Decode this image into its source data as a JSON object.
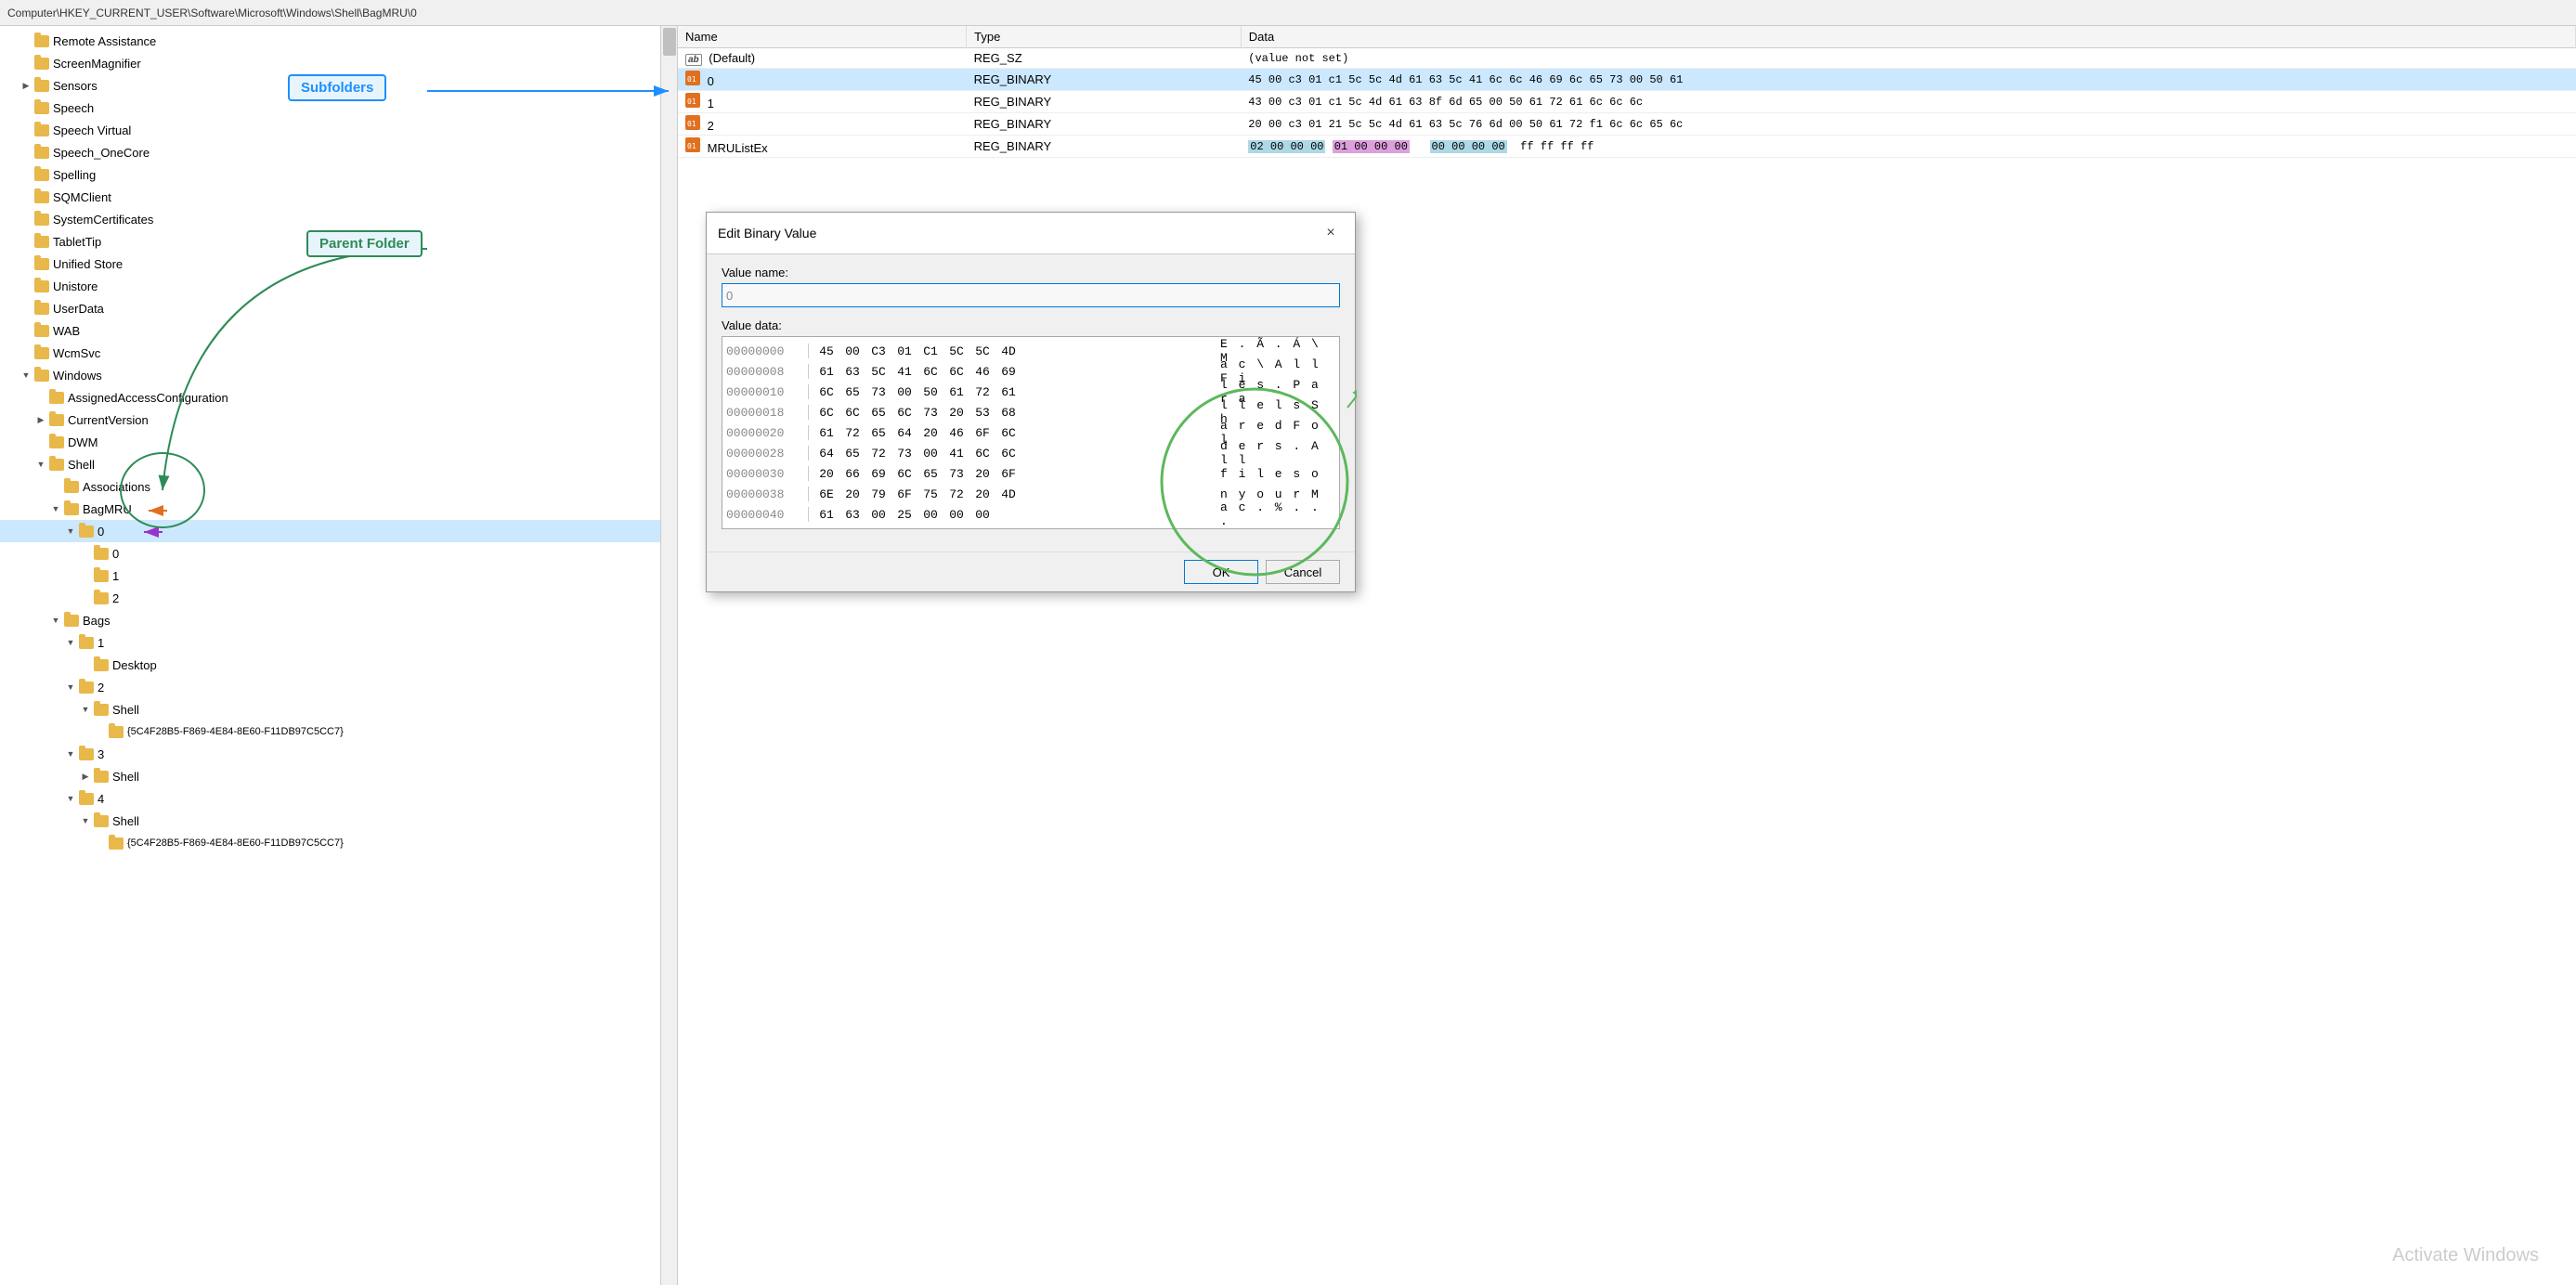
{
  "addressBar": {
    "path": "Computer\\HKEY_CURRENT_USER\\Software\\Microsoft\\Windows\\Shell\\BagMRU\\0"
  },
  "annotations": {
    "subfolders": {
      "label": "Subfolders",
      "color": "blue"
    },
    "parentFolder": {
      "label": "Parent Folder",
      "color": "green"
    }
  },
  "treeItems": [
    {
      "id": "remote-assistance",
      "indent": 1,
      "label": "Remote Assistance",
      "expander": "",
      "open": false
    },
    {
      "id": "screen-magnifier",
      "indent": 1,
      "label": "ScreenMagnifier",
      "expander": "",
      "open": false
    },
    {
      "id": "sensors",
      "indent": 1,
      "label": "Sensors",
      "expander": ">",
      "open": false
    },
    {
      "id": "speech",
      "indent": 1,
      "label": "Speech",
      "expander": "",
      "open": false
    },
    {
      "id": "speech-virtual",
      "indent": 1,
      "label": "Speech Virtual",
      "expander": "",
      "open": false
    },
    {
      "id": "speech-onecore",
      "indent": 1,
      "label": "Speech_OneCore",
      "expander": "",
      "open": false
    },
    {
      "id": "spelling",
      "indent": 1,
      "label": "Spelling",
      "expander": "",
      "open": false
    },
    {
      "id": "sqmclient",
      "indent": 1,
      "label": "SQMClient",
      "expander": "",
      "open": false
    },
    {
      "id": "systemcertificates",
      "indent": 1,
      "label": "SystemCertificates",
      "expander": "",
      "open": false
    },
    {
      "id": "tablettip",
      "indent": 1,
      "label": "TabletTip",
      "expander": "",
      "open": false
    },
    {
      "id": "unified-store",
      "indent": 1,
      "label": "Unified Store",
      "expander": "",
      "open": false
    },
    {
      "id": "unistore",
      "indent": 1,
      "label": "Unistore",
      "expander": "",
      "open": false
    },
    {
      "id": "userdata",
      "indent": 1,
      "label": "UserData",
      "expander": "",
      "open": false
    },
    {
      "id": "wab",
      "indent": 1,
      "label": "WAB",
      "expander": "",
      "open": false
    },
    {
      "id": "wcmsvc",
      "indent": 1,
      "label": "WcmSvc",
      "expander": "",
      "open": false
    },
    {
      "id": "windows",
      "indent": 1,
      "label": "Windows",
      "expander": "v",
      "open": true
    },
    {
      "id": "assigned-access",
      "indent": 2,
      "label": "AssignedAccessConfiguration",
      "expander": "",
      "open": false
    },
    {
      "id": "current-version",
      "indent": 2,
      "label": "CurrentVersion",
      "expander": ">",
      "open": false
    },
    {
      "id": "dwm",
      "indent": 2,
      "label": "DWM",
      "expander": "",
      "open": false
    },
    {
      "id": "shell",
      "indent": 2,
      "label": "Shell",
      "expander": "v",
      "open": true
    },
    {
      "id": "associations",
      "indent": 3,
      "label": "Associations",
      "expander": "",
      "open": false
    },
    {
      "id": "bagmru",
      "indent": 3,
      "label": "BagMRU",
      "expander": "v",
      "open": true
    },
    {
      "id": "bagmru-0",
      "indent": 4,
      "label": "0",
      "expander": "v",
      "open": true,
      "selected": true
    },
    {
      "id": "bagmru-0-0",
      "indent": 5,
      "label": "0",
      "expander": "",
      "open": false
    },
    {
      "id": "bagmru-0-1",
      "indent": 5,
      "label": "1",
      "expander": "",
      "open": false
    },
    {
      "id": "bagmru-0-2",
      "indent": 5,
      "label": "2",
      "expander": "",
      "open": false
    },
    {
      "id": "bags",
      "indent": 3,
      "label": "Bags",
      "expander": "v",
      "open": true
    },
    {
      "id": "bags-1",
      "indent": 4,
      "label": "1",
      "expander": "v",
      "open": true
    },
    {
      "id": "bags-1-desktop",
      "indent": 5,
      "label": "Desktop",
      "expander": "",
      "open": false
    },
    {
      "id": "bags-2",
      "indent": 4,
      "label": "2",
      "expander": "v",
      "open": true
    },
    {
      "id": "bags-2-shell",
      "indent": 5,
      "label": "Shell",
      "expander": "v",
      "open": true
    },
    {
      "id": "bags-2-shell-guid",
      "indent": 6,
      "label": "{5C4F28B5-F869-4E84-8E60-F11DB97C5CC7}",
      "expander": "",
      "open": false
    },
    {
      "id": "bags-3",
      "indent": 4,
      "label": "3",
      "expander": "v",
      "open": true
    },
    {
      "id": "bags-3-shell",
      "indent": 5,
      "label": "Shell",
      "expander": ">",
      "open": false
    },
    {
      "id": "bags-4",
      "indent": 4,
      "label": "4",
      "expander": "v",
      "open": true
    },
    {
      "id": "bags-4-shell",
      "indent": 5,
      "label": "Shell",
      "expander": "v",
      "open": true
    },
    {
      "id": "bags-4-shell-guid",
      "indent": 6,
      "label": "{5C4F28B5-F869-4E84-8E60-F11DB97C5CC7}",
      "expander": "",
      "open": false
    }
  ],
  "regTable": {
    "columns": [
      "Name",
      "Type",
      "Data"
    ],
    "rows": [
      {
        "icon": "ab",
        "name": "(Default)",
        "type": "REG_SZ",
        "data": "(value not set)"
      },
      {
        "icon": "binary",
        "name": "0",
        "type": "REG_BINARY",
        "data": "45 00 c3 01 c1 5c 5c 4d 61 63 5c 41 6c 6c 46 69 6c 65 73 00 50 61",
        "highlightStart": 0,
        "highlightEnd": -1
      },
      {
        "icon": "binary",
        "name": "1",
        "type": "REG_BINARY",
        "data": "43 00 c3 01 c1 5c 4d 61 63 8f 6d 65 00 50 61 72 61 6c 6c 6c"
      },
      {
        "icon": "binary",
        "name": "2",
        "type": "REG_BINARY",
        "data": "20 00 c3 01 21 5c 5c 4d 61 63 5c 76 6d 00 50 61 72 f1 6c 6c 65 6c"
      },
      {
        "icon": "binary",
        "name": "MRUListEx",
        "type": "REG_BINARY",
        "data": "02 00 00 00 01 00 00 00 00 00 00 00 ff ff ff ff",
        "hasBlueHighlight": true,
        "hasPurpleHighlight": true
      }
    ]
  },
  "dialog": {
    "title": "Edit Binary Value",
    "closeButton": "×",
    "valueNameLabel": "Value name:",
    "valueName": "0",
    "valueDataLabel": "Value data:",
    "hexRows": [
      {
        "addr": "00000000",
        "bytes": [
          "45",
          "00",
          "C3",
          "01",
          "C1",
          "5C",
          "5C",
          "4D"
        ],
        "ascii": "E . Ã . Á \\ M"
      },
      {
        "addr": "00000008",
        "bytes": [
          "61",
          "63",
          "5C",
          "41",
          "6C",
          "6C",
          "46",
          "69"
        ],
        "ascii": "a c \\ A l l F i"
      },
      {
        "addr": "00000010",
        "bytes": [
          "6C",
          "65",
          "73",
          "00",
          "50",
          "61",
          "72",
          "61"
        ],
        "ascii": "l e s . P a r a"
      },
      {
        "addr": "00000018",
        "bytes": [
          "6C",
          "6C",
          "65",
          "6C",
          "73",
          "20",
          "53",
          "68"
        ],
        "ascii": "l l e l s   S h"
      },
      {
        "addr": "00000020",
        "bytes": [
          "61",
          "72",
          "65",
          "64",
          "20",
          "46",
          "6F",
          "6C"
        ],
        "ascii": "a r e d   F o l"
      },
      {
        "addr": "00000028",
        "bytes": [
          "64",
          "65",
          "72",
          "73",
          "00",
          "41",
          "6C",
          "6C"
        ],
        "ascii": "d e r s . A l l"
      },
      {
        "addr": "00000030",
        "bytes": [
          "20",
          "66",
          "69",
          "6C",
          "65",
          "73",
          "20",
          "6F"
        ],
        "ascii": "  f i l e s   o"
      },
      {
        "addr": "00000038",
        "bytes": [
          "6E",
          "20",
          "79",
          "6F",
          "75",
          "72",
          "20",
          "4D"
        ],
        "ascii": "n   y o u r   M"
      },
      {
        "addr": "00000040",
        "bytes": [
          "61",
          "63",
          "00",
          "25",
          "00",
          "00",
          "00"
        ],
        "ascii": "a c . % . . ."
      }
    ],
    "okButton": "OK",
    "cancelButton": "Cancel"
  },
  "watermark": {
    "text": "Activate Windows"
  }
}
